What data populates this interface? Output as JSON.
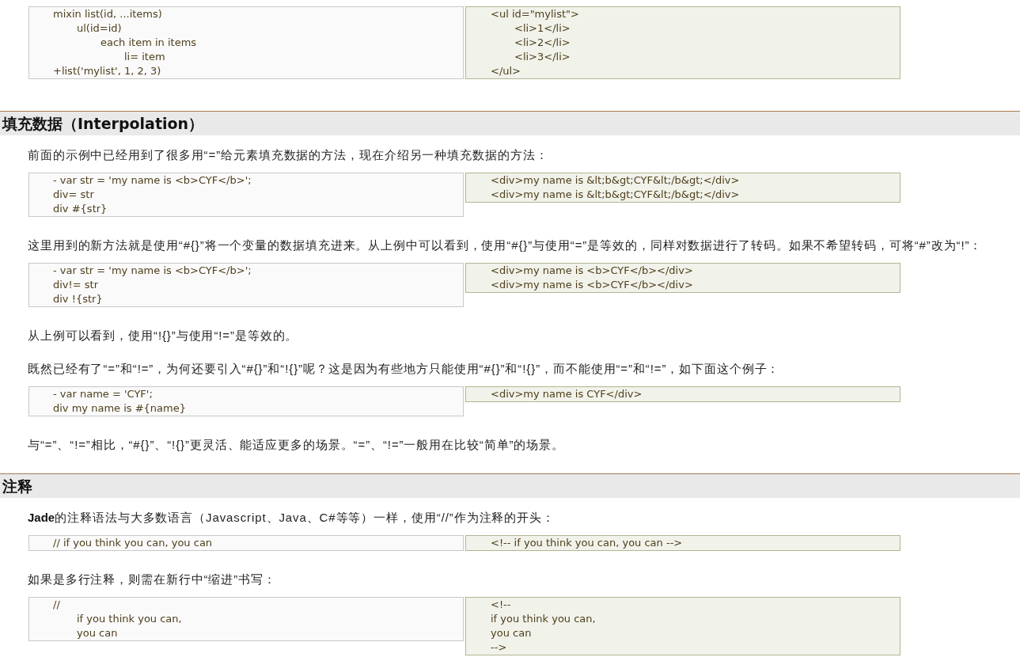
{
  "content": [
    {
      "kind": "code_pair",
      "jade": [
        {
          "text": "mixin list(id, ...items)",
          "children": [
            {
              "text": "ul(id=id)",
              "children": [
                {
                  "text": "each item in items",
                  "children": [
                    {
                      "text": "li= item"
                    }
                  ]
                }
              ]
            }
          ]
        },
        {
          "text": "+list('mylist', 1, 2, 3)"
        }
      ],
      "html": [
        {
          "text": "<ul id=\"mylist\">",
          "children": [
            {
              "text": "<li>1</li>"
            },
            {
              "text": "<li>2</li>"
            },
            {
              "text": "<li>3</li>"
            }
          ]
        },
        {
          "text": "</ul>"
        }
      ]
    },
    {
      "kind": "heading",
      "text": "填充数据（Interpolation）"
    },
    {
      "kind": "paragraph",
      "text": "前面的示例中已经用到了很多用“=”给元素填充数据的方法，现在介绍另一种填充数据的方法："
    },
    {
      "kind": "code_pair",
      "jade": [
        {
          "text": "- var str = 'my name is <b>CYF</b>';"
        },
        {
          "text": "div= str"
        },
        {
          "text": "div #{str}"
        }
      ],
      "html": [
        {
          "text": "<div>my name is &lt;b&gt;CYF&lt;/b&gt;</div>"
        },
        {
          "text": "<div>my name is &lt;b&gt;CYF&lt;/b&gt;</div>"
        }
      ]
    },
    {
      "kind": "paragraph",
      "text": "这里用到的新方法就是使用“#{}”将一个变量的数据填充进来。从上例中可以看到，使用“#{}”与使用“=”是等效的，同样对数据进行了转码。如果不希望转码，可将“#”改为“!”："
    },
    {
      "kind": "code_pair",
      "jade": [
        {
          "text": "- var str = 'my name is <b>CYF</b>';"
        },
        {
          "text": "div!= str"
        },
        {
          "text": "div !{str}"
        }
      ],
      "html": [
        {
          "text": "<div>my name is <b>CYF</b></div>"
        },
        {
          "text": "<div>my name is <b>CYF</b></div>"
        }
      ]
    },
    {
      "kind": "paragraph",
      "text": "从上例可以看到，使用“!{}”与使用“!=”是等效的。"
    },
    {
      "kind": "paragraph",
      "text": "既然已经有了“=”和“!=”，为何还要引入“#{}”和“!{}”呢？这是因为有些地方只能使用“#{}”和“!{}”，而不能使用“=”和“!=”，如下面这个例子："
    },
    {
      "kind": "code_pair",
      "jade": [
        {
          "text": "- var name = 'CYF';"
        },
        {
          "text": "div my name is #{name}"
        }
      ],
      "html": [
        {
          "text": "<div>my name is CYF</div>"
        }
      ]
    },
    {
      "kind": "paragraph",
      "text": "与“=”、“!=”相比，“#{}”、“!{}”更灵活、能适应更多的场景。“=”、“!=”一般用在比较“简单”的场景。"
    },
    {
      "kind": "heading",
      "text": "注释"
    },
    {
      "kind": "paragraph",
      "text": "**Jade**的注释语法与大多数语言（Javascript、Java、C#等等）一样，使用“//”作为注释的开头："
    },
    {
      "kind": "code_pair",
      "jade": [
        {
          "text": "// if you think you can, you can"
        }
      ],
      "html": [
        {
          "text": "<!-- if you think you can, you can -->"
        }
      ]
    },
    {
      "kind": "paragraph",
      "text": "如果是多行注释，则需在新行中“缩进”书写："
    },
    {
      "kind": "code_pair",
      "jade": [
        {
          "text": "//",
          "children": [
            {
              "text": "if you think you can,"
            },
            {
              "text": "you can"
            }
          ]
        }
      ],
      "html": [
        {
          "text": "<!--"
        },
        {
          "text": "if you think you can,"
        },
        {
          "text": "you can"
        },
        {
          "text": "-->"
        }
      ]
    }
  ]
}
